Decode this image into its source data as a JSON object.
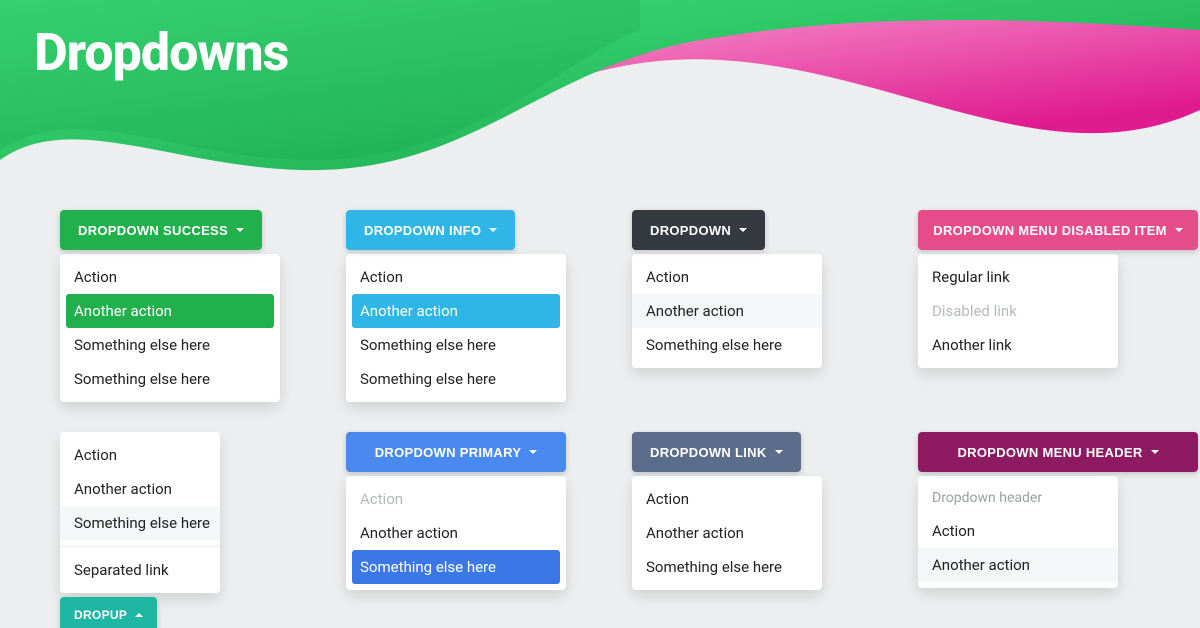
{
  "page": {
    "title": "Dropdowns"
  },
  "dropdowns": {
    "success": {
      "label": "DROPDOWN SUCCESS",
      "items": [
        "Action",
        "Another action",
        "Something else here",
        "Something else here"
      ]
    },
    "info": {
      "label": "DROPDOWN INFO",
      "items": [
        "Action",
        "Another action",
        "Something else here",
        "Something else here"
      ]
    },
    "dark": {
      "label": "DROPDOWN",
      "items": [
        "Action",
        "Another action",
        "Something else here"
      ]
    },
    "disabled": {
      "label": "DROPDOWN MENU DISABLED ITEM",
      "items": [
        "Regular link",
        "Disabled link",
        "Another link"
      ]
    },
    "dropup": {
      "label": "DROPUP",
      "items": [
        "Action",
        "Another action",
        "Something else here",
        "Separated link"
      ]
    },
    "primary": {
      "label": "DROPDOWN PRIMARY",
      "items": [
        "Action",
        "Another action",
        "Something else here"
      ]
    },
    "link": {
      "label": "DROPDOWN LINK",
      "items": [
        "Action",
        "Another action",
        "Something else here"
      ]
    },
    "header": {
      "label": "DROPDOWN MENU HEADER",
      "header": "Dropdown header",
      "items": [
        "Action",
        "Another action"
      ]
    }
  },
  "colors": {
    "success": "#21b04b",
    "info": "#30b6e6",
    "dark": "#343a40",
    "pink": "#e64c8a",
    "teal": "#1fb6a4",
    "primary": "#4a89ef",
    "slate": "#5a6e8c",
    "purple": "#8e1b62"
  }
}
